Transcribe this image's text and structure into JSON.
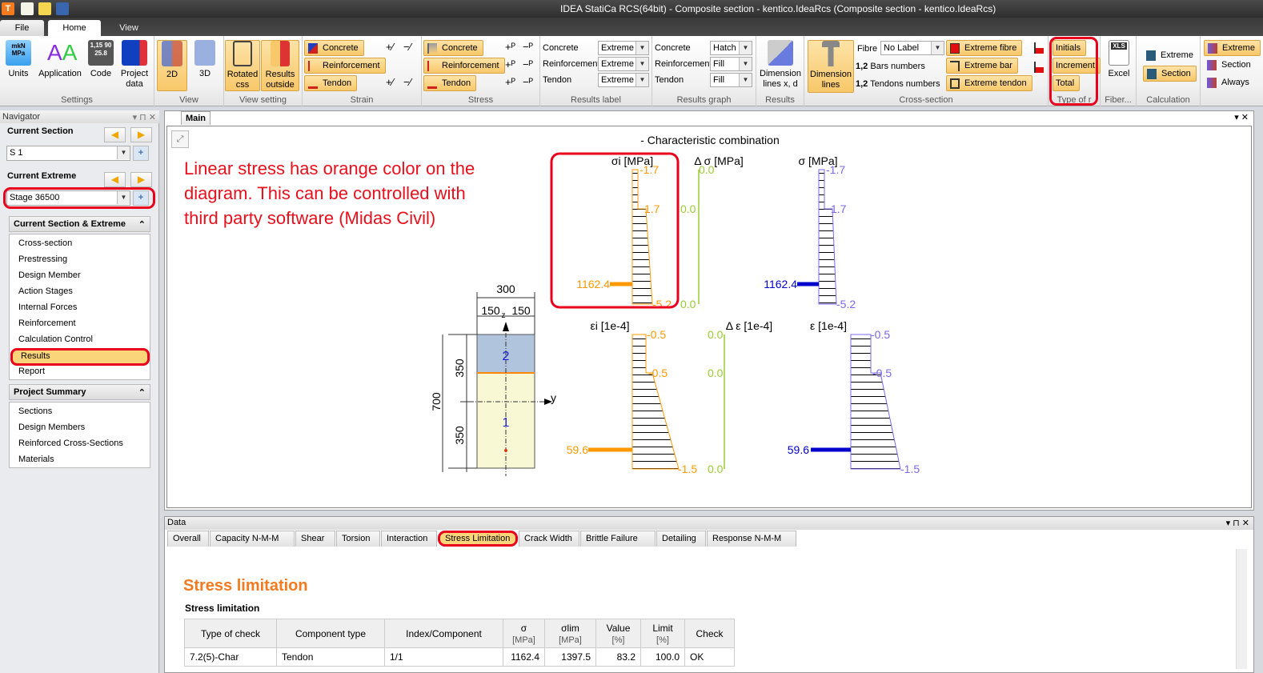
{
  "app": {
    "title": "IDEA StatiCa RCS(64bit) - Composite section - kentico.IdeaRcs (Composite section - kentico.IdeaRcs)"
  },
  "ribbon_tabs": [
    "File",
    "Home",
    "View"
  ],
  "groups": {
    "settings": {
      "label": "Settings",
      "buttons": [
        "Units",
        "Application",
        "Code",
        "Project data"
      ],
      "units_icon": [
        "m",
        "kN",
        "MPa"
      ],
      "code_icon": [
        "1,15",
        "90",
        "25.8"
      ]
    },
    "view": {
      "label": "View",
      "buttons": [
        "2D",
        "3D"
      ]
    },
    "view_setting": {
      "label": "View setting",
      "buttons": [
        "Rotated css",
        "Results outside"
      ]
    },
    "strain": {
      "label": "Strain",
      "buttons": [
        "Concrete",
        "Reinforcement",
        "Tendon"
      ]
    },
    "stress": {
      "label": "Stress",
      "buttons": [
        "Concrete",
        "Reinforcement",
        "Tendon"
      ]
    },
    "results_label": {
      "label": "Results label",
      "rows": [
        {
          "name": "Concrete",
          "value": "Extreme"
        },
        {
          "name": "Reinforcement",
          "value": "Extreme"
        },
        {
          "name": "Tendon",
          "value": "Extreme"
        }
      ]
    },
    "results_graph": {
      "label": "Results graph",
      "rows": [
        {
          "name": "Concrete",
          "value": "Hatch"
        },
        {
          "name": "Reinforcement",
          "value": "Fill"
        },
        {
          "name": "Tendon",
          "value": "Fill"
        }
      ]
    },
    "results": {
      "label": "Results",
      "button": "Dimension lines x, d"
    },
    "cross_section": {
      "label": "Cross-section",
      "dimension_lines": "Dimension lines",
      "fibre_label": "Fibre",
      "fibre_value": "No Label",
      "bars_numbers": "Bars numbers",
      "tendons_numbers": "Tendons numbers",
      "num_prefix": "1,2",
      "extreme_fibre": "Extreme fibre",
      "extreme_bar": "Extreme bar",
      "extreme_tendon": "Extreme tendon"
    },
    "type_of_result": {
      "label": "Type of r",
      "buttons": [
        "Initials",
        "Increment",
        "Total"
      ]
    },
    "fiber": {
      "label": "Fiber...",
      "button": "Excel",
      "icon_text": "XLS"
    },
    "calculation": {
      "label": "Calculation",
      "buttons": [
        "Extreme",
        "Section"
      ]
    },
    "extra": {
      "buttons": [
        "Extreme",
        "Section",
        "Always"
      ]
    }
  },
  "navigator": {
    "title": "Navigator",
    "current_section_label": "Current Section",
    "current_section_value": "S 1",
    "current_extreme_label": "Current Extreme",
    "current_extreme_value": "Stage 36500",
    "section1_title": "Current Section & Extreme",
    "section1_items": [
      "Cross-section",
      "Prestressing",
      "Design Member",
      "Action Stages",
      "Internal Forces",
      "Reinforcement",
      "Calculation Control",
      "Results",
      "Report"
    ],
    "selected_item": "Results",
    "section2_title": "Project Summary",
    "section2_items": [
      "Sections",
      "Design Members",
      "Reinforced Cross-Sections",
      "Materials"
    ]
  },
  "main": {
    "tab": "Main",
    "title": "- Characteristic combination",
    "annotation": [
      "Linear stress has orange color on the",
      "diagram. This can be controlled with",
      "third party software (Midas Civil)"
    ],
    "diagrams": {
      "sigma_i": {
        "title": "σi [MPa]",
        "top": "-1.7",
        "mid": "1.7",
        "bottom": "-5.2",
        "tendon": "1162.4"
      },
      "d_sigma": {
        "title": "Δ σ [MPa]",
        "top": "0.0",
        "mid": "0.0",
        "bottom": "0.0"
      },
      "sigma": {
        "title": "σ [MPa]",
        "top": "-1.7",
        "mid": "1.7",
        "bottom": "-5.2",
        "tendon": "1162.4"
      },
      "eps_i": {
        "title": "εi [1e-4]",
        "top": "-0.5",
        "mid": "-0.5",
        "bottom": "-1.5",
        "tendon": "59.6"
      },
      "d_eps": {
        "title": "Δ ε [1e-4]",
        "top": "0.0",
        "mid": "0.0",
        "bottom": "0.0"
      },
      "eps": {
        "title": "ε [1e-4]",
        "top": "-0.5",
        "mid": "-0.5",
        "bottom": "-1.5",
        "tendon": "59.6"
      }
    },
    "section": {
      "width": "300",
      "half1": "150",
      "half2": "150",
      "height": "700",
      "h1": "350",
      "h2": "350",
      "part_top": "2",
      "part_bottom": "1",
      "axis_y": "y",
      "axis_z": "z"
    },
    "colors": {
      "initial": "#ff9900",
      "increment": "#99cc33",
      "total": "#7b68ee",
      "tendon_total": "#0000cc"
    }
  },
  "data_panel": {
    "title": "Data",
    "tabs": [
      "Overall",
      "Capacity N-M-M",
      "Shear",
      "Torsion",
      "Interaction",
      "Stress Limitation",
      "Crack Width",
      "Brittle Failure",
      "Detailing",
      "Response N-M-M"
    ],
    "active_tab": "Stress Limitation",
    "heading": "Stress limitation",
    "subheading": "Stress limitation",
    "table": {
      "headers": [
        [
          "Type of check",
          ""
        ],
        [
          "Component type",
          ""
        ],
        [
          "Index/Component",
          ""
        ],
        [
          "σ",
          "[MPa]"
        ],
        [
          "σlim",
          "[MPa]"
        ],
        [
          "Value",
          "[%]"
        ],
        [
          "Limit",
          "[%]"
        ],
        [
          "Check",
          ""
        ]
      ],
      "rows": [
        [
          "7.2(5)-Char",
          "Tendon",
          "1/1",
          "1162.4",
          "1397.5",
          "83.2",
          "100.0",
          "OK"
        ]
      ]
    }
  }
}
